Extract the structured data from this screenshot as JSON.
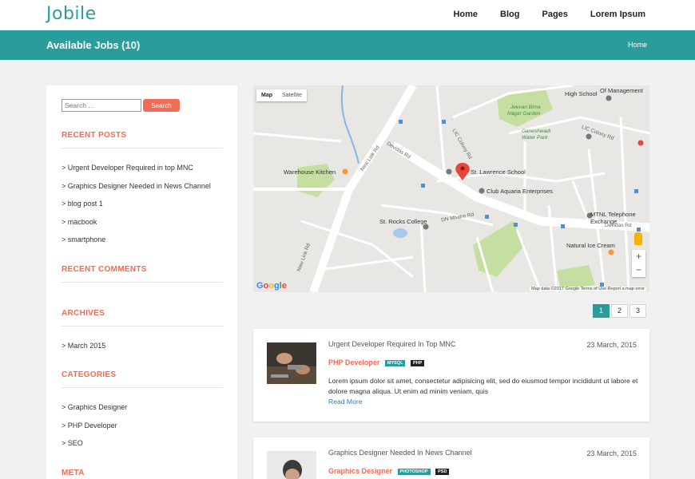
{
  "brand": {
    "logo": "Jobile"
  },
  "nav": {
    "items": [
      "Home",
      "Blog",
      "Pages",
      "Lorem Ipsum"
    ]
  },
  "banner": {
    "title": "Available Jobs (10)",
    "breadcrumb": "Home"
  },
  "sidebar": {
    "search": {
      "placeholder": "Search ...",
      "button": "Search"
    },
    "recent_posts": {
      "heading": "RECENT POSTS",
      "items": [
        "Urgent Developer Required in top MNC",
        "Graphics Designer Needed in News Channel",
        "blog post 1",
        "macbook",
        "smartphone"
      ]
    },
    "recent_comments": {
      "heading": "RECENT COMMENTS"
    },
    "archives": {
      "heading": "ARCHIVES",
      "items": [
        "March 2015"
      ]
    },
    "categories": {
      "heading": "CATEGORIES",
      "items": [
        "Graphics Designer",
        "PHP Developer",
        "SEO"
      ]
    },
    "meta": {
      "heading": "META"
    }
  },
  "map": {
    "map_button": "Map",
    "satellite_button": "Satellite",
    "zoom_in": "+",
    "zoom_out": "−",
    "google_logo": "Google",
    "footer": "Map data ©2017 Google   Terms of Use   Report a map error",
    "places": {
      "school": "St. Lawrence School",
      "club": "Club Aquaria Enterprises",
      "kitchen": "Warehouse Kitchen",
      "college": "St. Rocks College",
      "mtnl": "MTNL Telephone",
      "mtnl2": "Exchange",
      "icecream": "Natural Ice Cream",
      "highschool": "High School",
      "management": "Of Management",
      "park": "Jeevan Bima",
      "park2": "Nagar Garden",
      "park3": "Ganeshwadi",
      "park4": "Water Park"
    },
    "roads": {
      "devidas": "Devidas Rd",
      "newlink": "New Link Rd",
      "newlink2": "New Link Rd",
      "lic": "LIC Colony Rd",
      "lic2": "LIC Colony Rd",
      "dn": "DN Mhatre Rd",
      "devidas2": "Devidas Rd"
    }
  },
  "pagination": {
    "pages": [
      "1",
      "2",
      "3"
    ],
    "active": "1"
  },
  "jobs": [
    {
      "title": "Urgent Developer Required In Top MNC",
      "date": "23 March, 2015",
      "role": "PHP Developer",
      "tags": [
        "MYSQL",
        "PHP"
      ],
      "description": "Lorem ipsum dolor sit amet, consectetur adipisicing elit, sed do eiusmod tempor incididunt ut labore et dolore magna aliqua. Ut enim ad minim veniam, quis",
      "read_more": "Read More"
    },
    {
      "title": "Graphics Designer Needed In News Channel",
      "date": "23 March, 2015",
      "role": "Graphics Designer",
      "tags": [
        "PHOTOSHOP",
        "PSD"
      ]
    }
  ],
  "colors": {
    "teal": "#2a9c9b",
    "accent": "#f06c57",
    "link": "#2a7fb3"
  }
}
